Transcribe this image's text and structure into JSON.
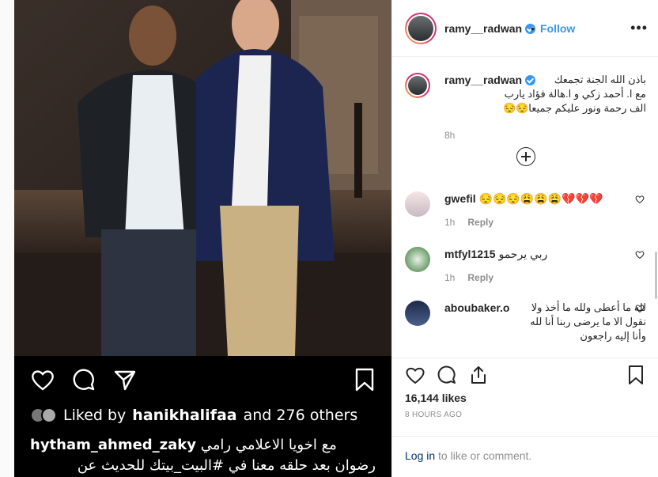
{
  "post": {
    "username": "ramy__radwan",
    "follow_label": "Follow",
    "more_label": "•••",
    "likes": "16,144 likes",
    "time_ago": "8 HOURS AGO",
    "login_link": "Log in",
    "login_rest": " to like or comment."
  },
  "caption": {
    "username": "ramy__radwan",
    "line1": "باذن الله الجنة تجمعك",
    "line2": "مع ا. أحمد زكي و ا.هالة فؤاد يارب",
    "line3": "الف رحمة ونور عليكم جميعا😔😔",
    "time": "8h"
  },
  "comments": [
    {
      "username": "gwefil",
      "text": "😔😔😔😩😩😩💔💔💔",
      "time": "1h",
      "reply": "Reply"
    },
    {
      "username": "mtfyl1215",
      "text": "ربي يرحمو",
      "time": "1h",
      "reply": "Reply"
    },
    {
      "username": "aboubaker.o",
      "text": "لله ما أعطى ولله ما أخذ ولا نقول الا ما يرضى ربنا أنا لله وأنا إليه راجعون"
    }
  ],
  "screenshot_overlay": {
    "liked_by_prefix": "Liked by",
    "liked_by_user": "hanikhalifaa",
    "liked_by_suffix": "and 276 others",
    "cap_user": "hytham_ahmed_zaky",
    "cap_line1": "مع اخويا الاعلامي رامي",
    "cap_line2": "رضوان بعد حلقه معنا في #البيت_بيتك للحديث عن"
  },
  "colors": {
    "accent": "#3897f0",
    "link": "#003569",
    "muted": "#8e8e8e",
    "border": "#efefef"
  }
}
